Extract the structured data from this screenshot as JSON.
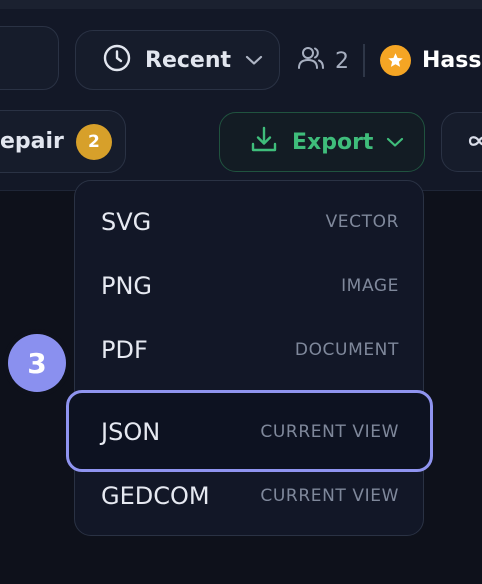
{
  "toolbar": {
    "recent_label": "Recent",
    "collaborators_count": "2",
    "user_name": "Hassa",
    "repair_label": "epair",
    "repair_count": "2",
    "export_label": "Export"
  },
  "export_menu": {
    "items": [
      {
        "format": "SVG",
        "hint": "VECTOR"
      },
      {
        "format": "PNG",
        "hint": "IMAGE"
      },
      {
        "format": "PDF",
        "hint": "DOCUMENT"
      },
      {
        "format": "JSON",
        "hint": "CURRENT VIEW",
        "focused": true
      },
      {
        "format": "GEDCOM",
        "hint": "CURRENT VIEW"
      }
    ]
  },
  "step_badge": "3",
  "icons": {
    "recent": "clock-icon",
    "recent_chevron": "chevron-down-icon",
    "collaborators": "users-icon",
    "user_badge": "star-icon",
    "export": "download-icon",
    "export_chevron": "chevron-down-icon",
    "extra": "infinity-icon"
  },
  "colors": {
    "background": "#0e111b",
    "export_accent": "#3fbd7b",
    "focus_ring": "#8f94f0",
    "count_badge": "#d7a02a",
    "star_badge": "#f5a524"
  }
}
